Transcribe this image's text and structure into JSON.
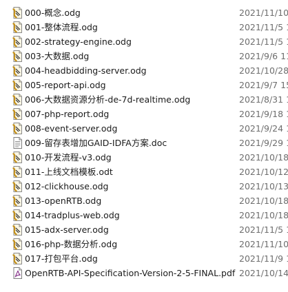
{
  "files": [
    {
      "name": "000-概念.odg",
      "date": "2021/11/10",
      "icon": "odg-document-icon"
    },
    {
      "name": "001-整体流程.odg",
      "date": "2021/11/5 1",
      "icon": "odg-document-icon"
    },
    {
      "name": "002-strategy-engine.odg",
      "date": "2021/11/5 1",
      "icon": "odg-document-icon"
    },
    {
      "name": "003-大数据.odg",
      "date": "2021/9/6 11",
      "icon": "odg-document-icon"
    },
    {
      "name": "004-headbidding-server.odg",
      "date": "2021/10/28",
      "icon": "odg-document-icon"
    },
    {
      "name": "005-report-api.odg",
      "date": "2021/9/7 15",
      "icon": "odg-document-icon"
    },
    {
      "name": "006-大数据资源分析-de-7d-realtime.odg",
      "date": "2021/8/31 1",
      "icon": "odg-document-icon"
    },
    {
      "name": "007-php-report.odg",
      "date": "2021/9/18 1",
      "icon": "odg-document-icon"
    },
    {
      "name": "008-event-server.odg",
      "date": "2021/9/24 1",
      "icon": "odg-document-icon"
    },
    {
      "name": "009-留存表增加GAID-IDFA方案.doc",
      "date": "2021/9/29 1",
      "icon": "doc-document-icon"
    },
    {
      "name": "010-开发流程-v3.odg",
      "date": "2021/10/18",
      "icon": "odg-document-icon"
    },
    {
      "name": "011-上线文档模板.odt",
      "date": "2021/10/12",
      "icon": "odt-document-icon"
    },
    {
      "name": "012-clickhouse.odg",
      "date": "2021/10/13",
      "icon": "odg-document-icon"
    },
    {
      "name": "013-openRTB.odg",
      "date": "2021/10/18",
      "icon": "odg-document-icon"
    },
    {
      "name": "014-tradplus-web.odg",
      "date": "2021/10/18",
      "icon": "odg-document-icon"
    },
    {
      "name": "015-adx-server.odg",
      "date": "2021/11/5 1",
      "icon": "odg-document-icon"
    },
    {
      "name": "016-php-数据分析.odg",
      "date": "2021/11/10",
      "icon": "odg-document-icon"
    },
    {
      "name": "017-打包平台.odg",
      "date": "2021/11/9 1",
      "icon": "odg-document-icon"
    },
    {
      "name": "OpenRTB-API-Specification-Version-2-5-FINAL.pdf",
      "date": "2021/10/14",
      "icon": "pdf-document-icon"
    }
  ],
  "colors": {
    "odg_icon_page": "#f4f0d8",
    "odg_icon_accent": "#c58f12",
    "pdf_icon_accent": "#8a3b8f",
    "text": "#1a1a1a",
    "date_text": "#6d6d6d"
  }
}
